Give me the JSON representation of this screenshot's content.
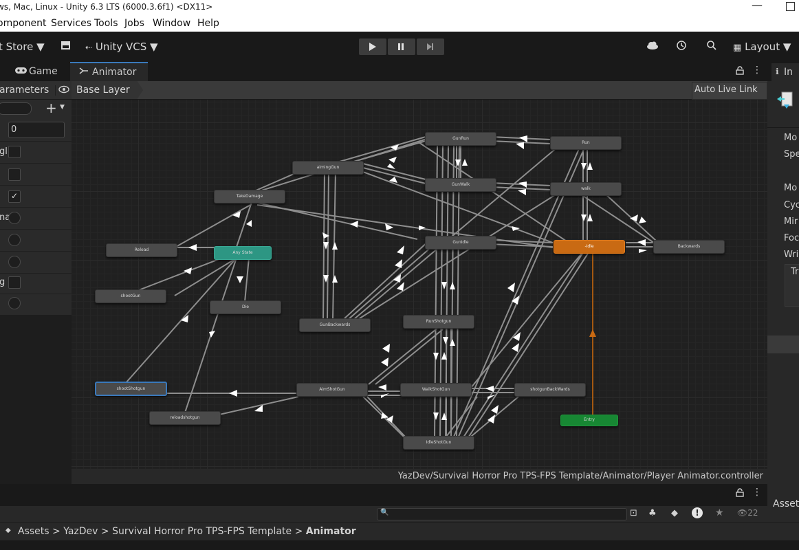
{
  "window": {
    "title": "ws, Mac, Linux - Unity 6.3 LTS (6000.3.6f1) <DX11>"
  },
  "menu": [
    "omponent",
    "Services",
    "Tools",
    "Jobs",
    "Window",
    "Help"
  ],
  "toolbar": {
    "asset_store": "t Store ▼",
    "vcs": "Unity VCS ▼",
    "layout": "Layout ▼"
  },
  "tabs": {
    "game": "Game",
    "animator": "Animator",
    "inspector": "In"
  },
  "animator": {
    "parameters_tab": "arameters",
    "layer": "Base Layer",
    "auto_live_link": "Auto Live Link",
    "path": "YazDev/Survival Horror Pro TPS-FPS Template/Animator/Player Animator.controller",
    "int_value": "0",
    "params": [
      {
        "label": "gl",
        "kind": "bool",
        "checked": false
      },
      {
        "label": "",
        "kind": "bool",
        "checked": false
      },
      {
        "label": "",
        "kind": "bool",
        "checked": true
      },
      {
        "label": "na",
        "kind": "trigger"
      },
      {
        "label": "",
        "kind": "trigger"
      },
      {
        "label": "",
        "kind": "trigger"
      },
      {
        "label": "g",
        "kind": "bool",
        "checked": false
      },
      {
        "label": "",
        "kind": "trigger"
      }
    ],
    "states": {
      "gunrun": "GunRun",
      "run": "Run",
      "aiminggun": "aimingGun",
      "gunwalk": "GunWalk",
      "walk": "walk",
      "takedamage": "TakeDamage",
      "gunidle": "GunIdle",
      "idle": "Idle",
      "backwards": "Backwards",
      "reload": "Reload",
      "anystate": "Any State",
      "shootgun": "shootGun",
      "die": "Die",
      "gunbackwards": "GunBackwards",
      "runshotgun": "RunShotgun",
      "shootshotgun": "shootShotgun",
      "aimshotgun": "AimShotGun",
      "walkshotgun": "WalkShotGun",
      "shotgunbackwards": "shotgunBackWards",
      "reloadshotgun": "reloadshotgun",
      "entry": "Entry",
      "idleshotgun": "IdleShotGun"
    }
  },
  "inspector": {
    "labels": [
      "Mo",
      "Spe",
      "Mo",
      "Cyc",
      "Mir",
      "Foc",
      "Wri",
      "Tr"
    ],
    "assets_label": "Asset"
  },
  "project": {
    "breadcrumb": [
      "Assets",
      "YazDev",
      "Survival Horror Pro TPS-FPS Template"
    ],
    "current": "Animator",
    "visible_count": "22"
  },
  "colors": {
    "accent": "#3a79bb",
    "default_state": "#c96a13",
    "any_state": "#2d9683",
    "entry_state": "#178733"
  }
}
